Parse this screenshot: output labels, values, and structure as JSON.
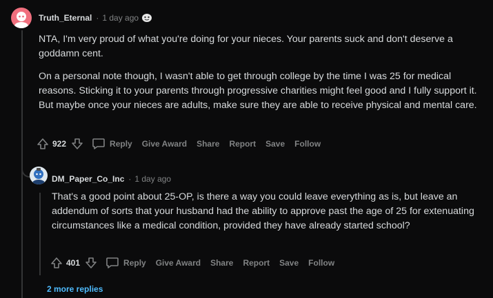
{
  "comment1": {
    "username": "Truth_Eternal",
    "separator": "·",
    "time": "1 day ago",
    "paragraphs": [
      "NTA, I'm very proud of what you're doing for your nieces. Your parents suck and don't deserve a goddamn cent.",
      "On a personal note though, I wasn't able to get through college by the time I was 25 for medical reasons. Sticking it to your parents through progressive charities might feel good and I fully support it. But maybe once your nieces are adults, make sure they are able to receive physical and mental care."
    ],
    "votes": "922",
    "actions": {
      "reply": "Reply",
      "give_award": "Give Award",
      "share": "Share",
      "report": "Report",
      "save": "Save",
      "follow": "Follow"
    }
  },
  "comment2": {
    "username": "DM_Paper_Co_Inc",
    "separator": "·",
    "time": "1 day ago",
    "paragraphs": [
      "That's a good point about 25-OP, is there a way you could leave everything as is, but leave an addendum of sorts that your husband had the ability to approve past the age of 25 for extenuating circumstances like a medical condition, provided they have already started school?"
    ],
    "votes": "401",
    "actions": {
      "reply": "Reply",
      "give_award": "Give Award",
      "share": "Share",
      "report": "Report",
      "save": "Save",
      "follow": "Follow"
    }
  },
  "more_replies": "2 more replies",
  "icons": [
    "avatar",
    "award-icon",
    "upvote-icon",
    "downvote-icon",
    "comment-icon"
  ],
  "colors": {
    "background": "#0b0b0c",
    "text": "#d7dadc",
    "muted": "#818384",
    "link": "#4fbcff",
    "avatar1": "#f06f7e"
  }
}
